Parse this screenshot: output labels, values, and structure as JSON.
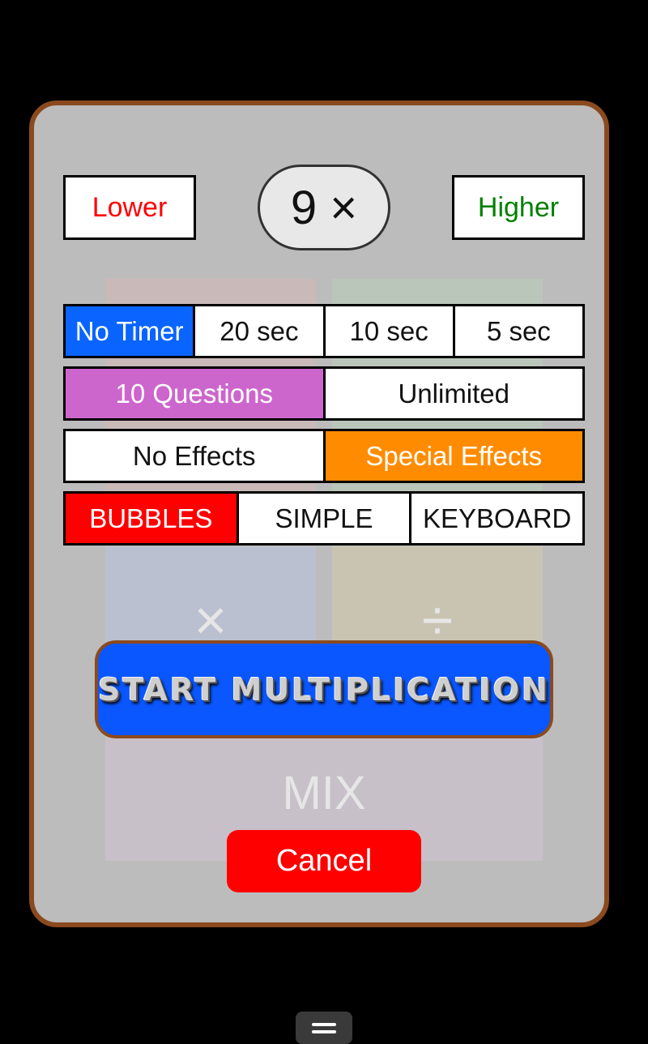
{
  "table_selector": {
    "lower_label": "Lower",
    "higher_label": "Higher",
    "current_table": "9 ×",
    "lower_color": "#ff0000",
    "higher_color": "#008000"
  },
  "timer_options": {
    "items": [
      "No Timer",
      "20 sec",
      "10 sec",
      "5 sec"
    ],
    "selected_index": 0,
    "selected_color": "#0a64ff"
  },
  "question_options": {
    "items": [
      "10 Questions",
      "Unlimited"
    ],
    "selected_index": 0,
    "selected_color": "#cc66cc"
  },
  "effects_options": {
    "items": [
      "No Effects",
      "Special Effects"
    ],
    "selected_index": 1,
    "selected_color": "#ff8c00"
  },
  "input_mode_options": {
    "items": [
      "BUBBLES",
      "SIMPLE",
      "KEYBOARD"
    ],
    "selected_index": 0,
    "selected_color": "#ff0000"
  },
  "background_tiles": {
    "multiply_symbol": "×",
    "divide_symbol": "÷",
    "mix_label": "MIX"
  },
  "start_button_label": "START MULTIPLICATION",
  "cancel_button_label": "Cancel",
  "colors": {
    "dialog_bg": "#bcbcbc",
    "dialog_border": "#8b4a1e",
    "start_bg": "#0a57ff",
    "cancel_bg": "#ff0000"
  },
  "nav": {
    "menu_icon": "hamburger-icon"
  }
}
